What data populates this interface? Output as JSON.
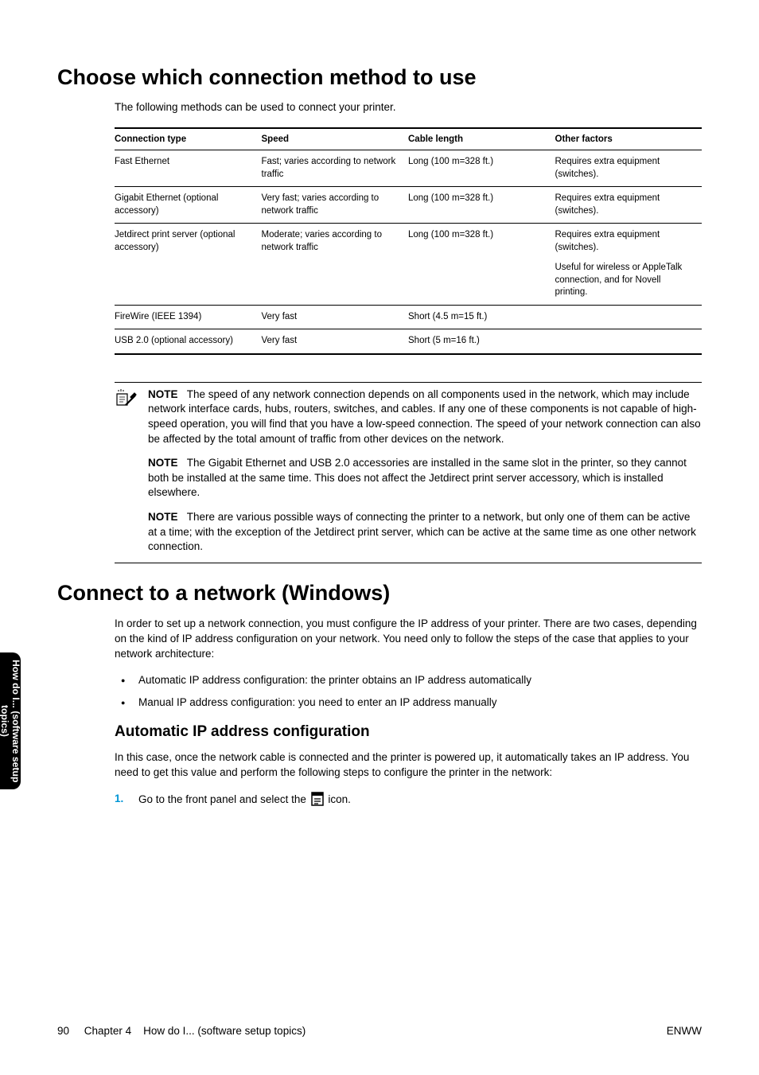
{
  "h1_choose": "Choose which connection method to use",
  "intro1": "The following methods can be used to connect your printer.",
  "table": {
    "headers": {
      "c1": "Connection type",
      "c2": "Speed",
      "c3": "Cable length",
      "c4": "Other factors"
    },
    "rows": [
      {
        "c1": "Fast Ethernet",
        "c2": "Fast; varies according to network traffic",
        "c3": "Long (100 m=328 ft.)",
        "c4": "Requires extra equipment (switches)."
      },
      {
        "c1": "Gigabit Ethernet (optional accessory)",
        "c2": "Very fast; varies according to network traffic",
        "c3": "Long (100 m=328 ft.)",
        "c4": "Requires extra equipment (switches)."
      },
      {
        "c1": "Jetdirect print server (optional accessory)",
        "c2": "Moderate; varies according to network traffic",
        "c3": "Long (100 m=328 ft.)",
        "c4a": "Requires extra equipment (switches).",
        "c4b": "Useful for wireless or AppleTalk connection, and for Novell printing."
      },
      {
        "c1": "FireWire (IEEE 1394)",
        "c2": "Very fast",
        "c3": "Short (4.5 m=15 ft.)",
        "c4": ""
      },
      {
        "c1": "USB 2.0 (optional accessory)",
        "c2": "Very fast",
        "c3": "Short (5 m=16 ft.)",
        "c4": ""
      }
    ]
  },
  "note_label": "NOTE",
  "notes": {
    "n1": "The speed of any network connection depends on all components used in the network, which may include network interface cards, hubs, routers, switches, and cables. If any one of these components is not capable of high-speed operation, you will find that you have a low-speed connection. The speed of your network connection can also be affected by the total amount of traffic from other devices on the network.",
    "n2": "The Gigabit Ethernet and USB 2.0 accessories are installed in the same slot in the printer, so they cannot both be installed at the same time. This does not affect the Jetdirect print server accessory, which is installed elsewhere.",
    "n3": "There are various possible ways of connecting the printer to a network, but only one of them can be active at a time; with the exception of the Jetdirect print server, which can be active at the same time as one other network connection."
  },
  "h1_connect": "Connect to a network (Windows)",
  "connect_intro": "In order to set up a network connection, you must configure the IP address of your printer. There are two cases, depending on the kind of IP address configuration on your network. You need only to follow the steps of the case that applies to your network architecture:",
  "bullets": {
    "b1": "Automatic IP address configuration: the printer obtains an IP address automatically",
    "b2": "Manual IP address configuration: you need to enter an IP address manually"
  },
  "h2_auto": "Automatic IP address configuration",
  "auto_intro": "In this case, once the network cable is connected and the printer is powered up, it automatically takes an IP address. You need to get this value and perform the following steps to configure the printer in the network:",
  "step1_num": "1.",
  "step1_a": "Go to the front panel and select the ",
  "step1_b": " icon.",
  "side_tab": "How do I... (software\nsetup topics)",
  "footer": {
    "page": "90",
    "chapter_label": "Chapter 4",
    "chapter_title": "How do I... (software setup topics)",
    "right": "ENWW"
  }
}
